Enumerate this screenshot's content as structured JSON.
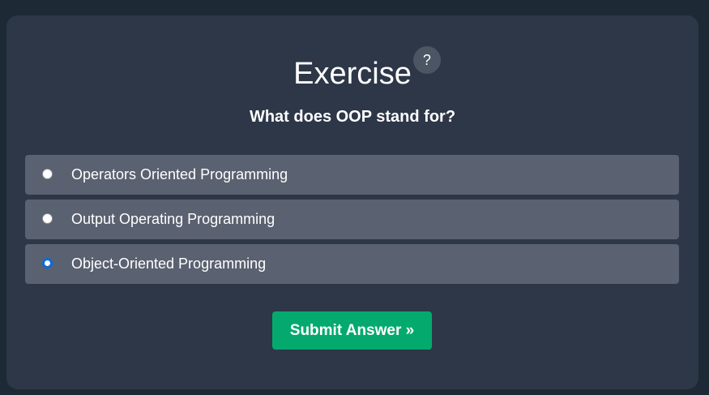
{
  "exercise": {
    "title": "Exercise",
    "help_label": "?",
    "question": "What does OOP stand for?",
    "options": [
      {
        "label": "Operators Oriented Programming",
        "selected": false
      },
      {
        "label": "Output Operating Programming",
        "selected": false
      },
      {
        "label": "Object-Oriented Programming",
        "selected": true
      }
    ],
    "submit_label": "Submit Answer »"
  },
  "colors": {
    "page_background": "#1d2a35",
    "panel_background": "#2d3748",
    "option_background": "#5a6170",
    "submit_background": "#04aa6d",
    "radio_selected": "#0b6bd6"
  }
}
